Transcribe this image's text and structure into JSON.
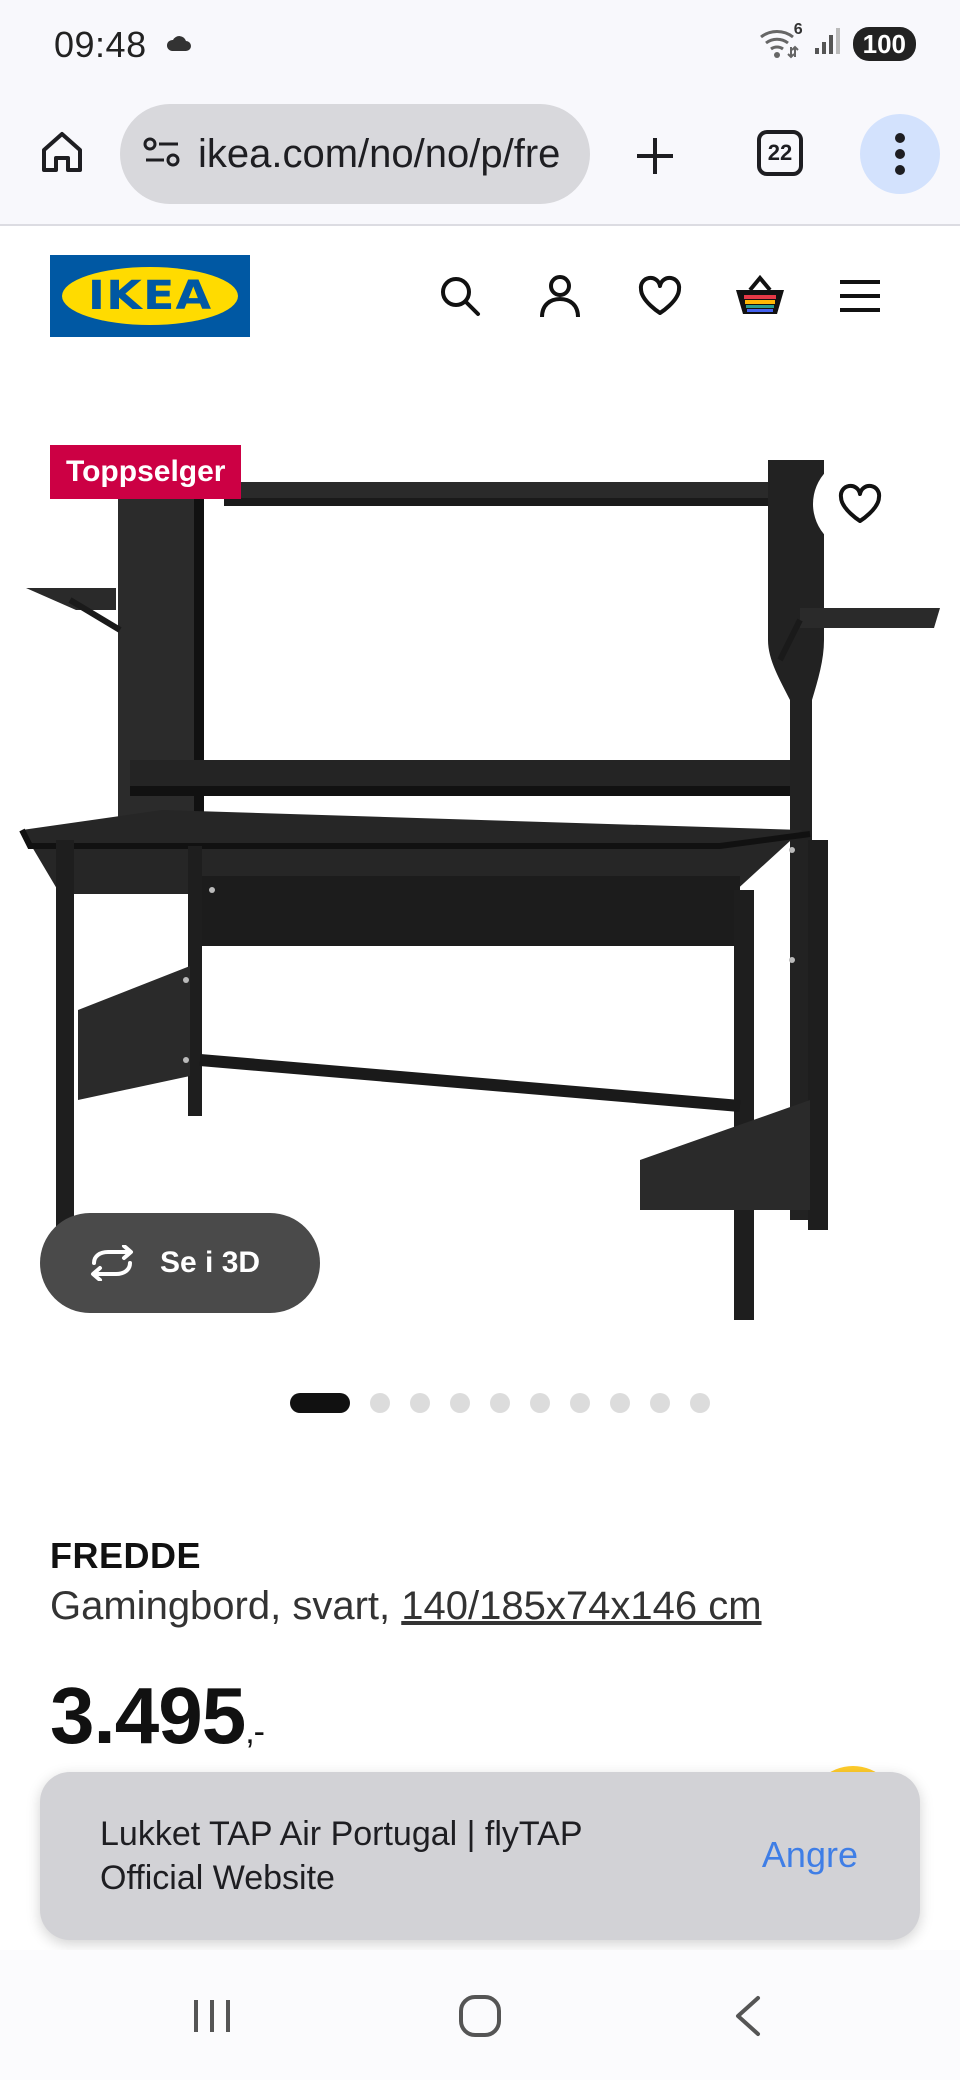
{
  "status_bar": {
    "time": "09:48",
    "wifi_badge": "6",
    "battery": "100",
    "cloud_icon": "cloud-icon",
    "wifi_icon": "wifi-icon",
    "signal_icon": "signal-icon"
  },
  "browser": {
    "url": "ikea.com/no/no/p/fre",
    "tab_count": "22",
    "home_icon": "home-icon",
    "site_settings_icon": "site-settings-icon",
    "new_tab_icon": "plus-icon",
    "menu_icon": "more-vertical-icon"
  },
  "site_header": {
    "logo_text": "IKEA",
    "icons": [
      "search-icon",
      "account-icon",
      "heart-icon",
      "basket-icon",
      "menu-icon"
    ],
    "brand_colors": {
      "blue": "#0058a3",
      "yellow": "#ffdb00"
    }
  },
  "product": {
    "badge": "Toppselger",
    "badge_color": "#cc0044",
    "view_3d_label": "Se i 3D",
    "gallery": {
      "total_images": 10,
      "active_index": 0
    },
    "name": "FREDDE",
    "description": "Gamingbord, svart,",
    "dimensions": "140/185x74x146 cm",
    "price": "3.495",
    "price_suffix": ",-"
  },
  "snackbar": {
    "message": "Lukket TAP Air Portugal | flyTAP Official Website",
    "action": "Angre",
    "action_color": "#3f7ee6"
  },
  "nav_bar": {
    "icons": [
      "recent-apps-icon",
      "home-circle-icon",
      "back-icon"
    ]
  }
}
